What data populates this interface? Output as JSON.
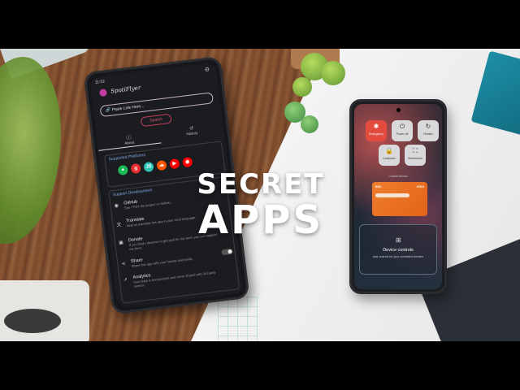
{
  "headline": {
    "line1": "SECRET",
    "line2": "APPS"
  },
  "left_phone": {
    "status_time": "11:02",
    "app_title": "SpotiFlyer",
    "search_placeholder": "Paste Link Here...",
    "search_button": "Search",
    "tabs": [
      {
        "label": "About",
        "icon": "info-icon"
      },
      {
        "label": "History",
        "icon": "history-icon"
      }
    ],
    "supported_title": "Supported Platforms",
    "platforms": [
      {
        "icon": "spotify-icon",
        "glyph": "●",
        "color": "#1DB954"
      },
      {
        "icon": "gaana-icon",
        "glyph": "g",
        "color": "#E72C30"
      },
      {
        "icon": "jiosaavn-icon",
        "glyph": "JS",
        "color": "#2BC5B4"
      },
      {
        "icon": "soundcloud-icon",
        "glyph": "☁",
        "color": "#FF5500"
      },
      {
        "icon": "youtube-icon",
        "glyph": "▶",
        "color": "#FF0000"
      },
      {
        "icon": "youtube-music-icon",
        "glyph": "◉",
        "color": "#FF0000"
      }
    ],
    "dev_title": "Support Development",
    "dev_items": [
      {
        "title": "GitHub",
        "sub": "Star / Fork the project on Github.",
        "icon": "github-icon"
      },
      {
        "title": "Translate",
        "sub": "Help us translate this app in your local language.",
        "icon": "translate-icon"
      },
      {
        "title": "Donate",
        "sub": "If you think I deserve to get paid for my work, you can support me here.",
        "icon": "donate-icon"
      },
      {
        "title": "Share",
        "sub": "Share this app with your friends and family.",
        "icon": "share-icon"
      },
      {
        "title": "Analytics",
        "sub": "Your Data is Anonymized and never shared with 3rd party service.",
        "icon": "analytics-icon"
      }
    ]
  },
  "right_phone": {
    "tiles": [
      {
        "label": "Emergency",
        "icon": "emergency-icon"
      },
      {
        "label": "Power off",
        "icon": "power-icon"
      },
      {
        "label": "Restart",
        "icon": "restart-icon"
      },
      {
        "label": "Lockdown",
        "icon": "lock-icon"
      },
      {
        "label": "Screenshot",
        "icon": "screenshot-icon"
      }
    ],
    "locked_text": "Locked Unlock",
    "card_bank": "ING",
    "card_brand": "VISA",
    "device_controls_title": "Device controls",
    "device_controls_sub": "Add controls for your connected devices"
  }
}
